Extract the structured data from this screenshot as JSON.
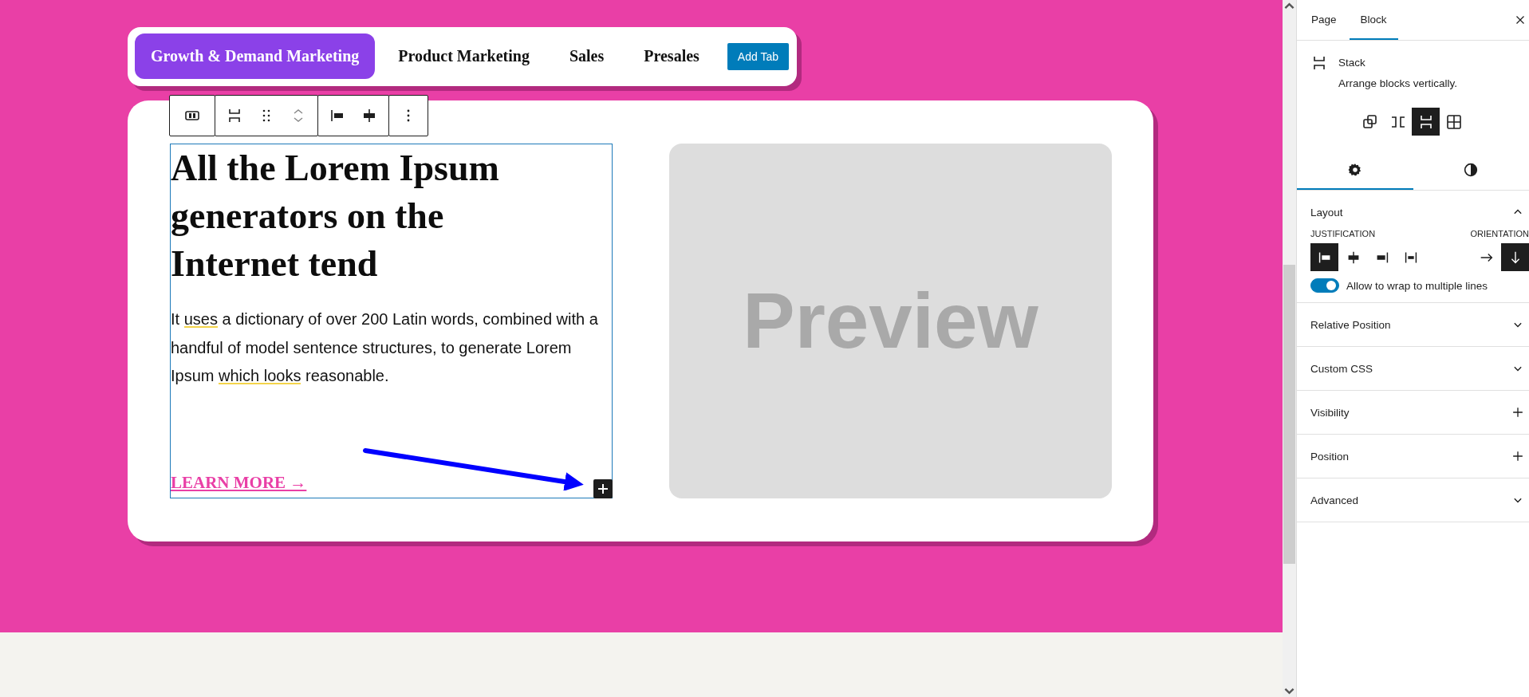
{
  "tab_bar": {
    "tabs": [
      {
        "label": "Growth & Demand Marketing",
        "selected": true
      },
      {
        "label": "Product Marketing",
        "selected": false
      },
      {
        "label": "Sales",
        "selected": false
      },
      {
        "label": "Presales",
        "selected": false
      }
    ],
    "add_button": "Add Tab"
  },
  "content": {
    "heading": "All the Lorem Ipsum generators on the Internet tend",
    "paragraph": [
      {
        "text": "It ",
        "underlined": false
      },
      {
        "text": "uses",
        "underlined": true
      },
      {
        "text": " a dictionary of over 200 Latin words, combined with a handful of model sentence structures, to generate Lorem Ipsum ",
        "underlined": false
      },
      {
        "text": "which looks",
        "underlined": true
      },
      {
        "text": " reasonable.",
        "underlined": false
      }
    ],
    "link": "LEARN MORE →"
  },
  "preview": {
    "label": "Preview"
  },
  "sidebar": {
    "tabs": [
      {
        "label": "Page",
        "selected": false
      },
      {
        "label": "Block",
        "selected": true
      }
    ],
    "block": {
      "title": "Stack",
      "description": "Arrange blocks vertically."
    },
    "variations": [
      {
        "kind": "group",
        "selected": false
      },
      {
        "kind": "row",
        "selected": false
      },
      {
        "kind": "stack",
        "selected": true
      },
      {
        "kind": "grid",
        "selected": false
      }
    ],
    "inspector_tabs": [
      {
        "kind": "settings",
        "selected": true
      },
      {
        "kind": "styles",
        "selected": false
      }
    ],
    "layout": {
      "title": "Layout",
      "expanded": true,
      "justification_label": "JUSTIFICATION",
      "justification": [
        {
          "kind": "left",
          "selected": true
        },
        {
          "kind": "center",
          "selected": false
        },
        {
          "kind": "right",
          "selected": false
        },
        {
          "kind": "space-between",
          "selected": false
        }
      ],
      "orientation_label": "ORIENTATION",
      "orientation": [
        {
          "kind": "horizontal",
          "selected": false
        },
        {
          "kind": "vertical",
          "selected": true
        }
      ],
      "wrap": {
        "label": "Allow to wrap to multiple lines",
        "on": true
      }
    },
    "panels": [
      {
        "title": "Relative Position",
        "kind": "collapsible",
        "expanded": false
      },
      {
        "title": "Custom CSS",
        "kind": "collapsible",
        "expanded": false
      },
      {
        "title": "Visibility",
        "kind": "addable",
        "expanded": false
      },
      {
        "title": "Position",
        "kind": "addable",
        "expanded": false
      },
      {
        "title": "Advanced",
        "kind": "collapsible",
        "expanded": false
      }
    ]
  }
}
